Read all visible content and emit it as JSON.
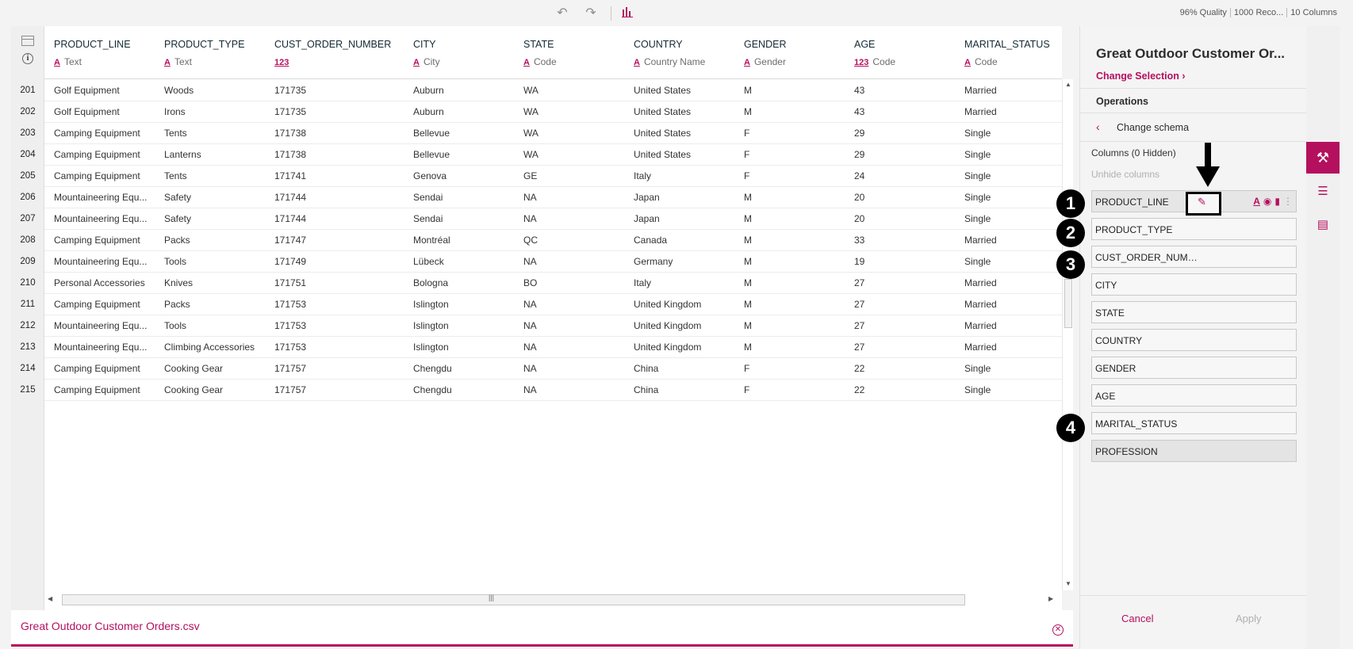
{
  "toolbar": {
    "undo_icon": "undo-icon",
    "redo_icon": "redo-icon",
    "chart_icon": "bar-chart-icon",
    "quality": "96% Quality",
    "records": "1000 Reco...",
    "columns": "10 Columns"
  },
  "grid": {
    "columns": [
      {
        "name": "PRODUCT_LINE",
        "glyph": "A",
        "type": "Text"
      },
      {
        "name": "PRODUCT_TYPE",
        "glyph": "A",
        "type": "Text"
      },
      {
        "name": "CUST_ORDER_NUMBER",
        "glyph": "123",
        "type": ""
      },
      {
        "name": "CITY",
        "glyph": "A",
        "type": "City"
      },
      {
        "name": "STATE",
        "glyph": "A",
        "type": "Code"
      },
      {
        "name": "COUNTRY",
        "glyph": "A",
        "type": "Country Name"
      },
      {
        "name": "GENDER",
        "glyph": "A",
        "type": "Gender"
      },
      {
        "name": "AGE",
        "glyph": "123",
        "type": "Code"
      },
      {
        "name": "MARITAL_STATUS",
        "glyph": "A",
        "type": "Code"
      }
    ],
    "rows": [
      {
        "n": "201",
        "cells": [
          "Golf Equipment",
          "Woods",
          "171735",
          "Auburn",
          "WA",
          "United States",
          "M",
          "43",
          "Married"
        ]
      },
      {
        "n": "202",
        "cells": [
          "Golf Equipment",
          "Irons",
          "171735",
          "Auburn",
          "WA",
          "United States",
          "M",
          "43",
          "Married"
        ]
      },
      {
        "n": "203",
        "cells": [
          "Camping Equipment",
          "Tents",
          "171738",
          "Bellevue",
          "WA",
          "United States",
          "F",
          "29",
          "Single"
        ]
      },
      {
        "n": "204",
        "cells": [
          "Camping Equipment",
          "Lanterns",
          "171738",
          "Bellevue",
          "WA",
          "United States",
          "F",
          "29",
          "Single"
        ]
      },
      {
        "n": "205",
        "cells": [
          "Camping Equipment",
          "Tents",
          "171741",
          "Genova",
          "GE",
          "Italy",
          "F",
          "24",
          "Single"
        ]
      },
      {
        "n": "206",
        "cells": [
          "Mountaineering Equ...",
          "Safety",
          "171744",
          "Sendai",
          "NA",
          "Japan",
          "M",
          "20",
          "Single"
        ]
      },
      {
        "n": "207",
        "cells": [
          "Mountaineering Equ...",
          "Safety",
          "171744",
          "Sendai",
          "NA",
          "Japan",
          "M",
          "20",
          "Single"
        ]
      },
      {
        "n": "208",
        "cells": [
          "Camping Equipment",
          "Packs",
          "171747",
          "Montréal",
          "QC",
          "Canada",
          "M",
          "33",
          "Married"
        ]
      },
      {
        "n": "209",
        "cells": [
          "Mountaineering Equ...",
          "Tools",
          "171749",
          "Lübeck",
          "NA",
          "Germany",
          "M",
          "19",
          "Single"
        ]
      },
      {
        "n": "210",
        "cells": [
          "Personal Accessories",
          "Knives",
          "171751",
          "Bologna",
          "BO",
          "Italy",
          "M",
          "27",
          "Married"
        ]
      },
      {
        "n": "211",
        "cells": [
          "Camping Equipment",
          "Packs",
          "171753",
          "Islington",
          "NA",
          "United Kingdom",
          "M",
          "27",
          "Married"
        ]
      },
      {
        "n": "212",
        "cells": [
          "Mountaineering Equ...",
          "Tools",
          "171753",
          "Islington",
          "NA",
          "United Kingdom",
          "M",
          "27",
          "Married"
        ]
      },
      {
        "n": "213",
        "cells": [
          "Mountaineering Equ...",
          "Climbing Accessories",
          "171753",
          "Islington",
          "NA",
          "United Kingdom",
          "M",
          "27",
          "Married"
        ]
      },
      {
        "n": "214",
        "cells": [
          "Camping Equipment",
          "Cooking Gear",
          "171757",
          "Chengdu",
          "NA",
          "China",
          "F",
          "22",
          "Single"
        ]
      },
      {
        "n": "215",
        "cells": [
          "Camping Equipment",
          "Cooking Gear",
          "171757",
          "Chengdu",
          "NA",
          "China",
          "F",
          "22",
          "Single"
        ]
      }
    ]
  },
  "file": {
    "name": "Great Outdoor Customer Orders.csv"
  },
  "panel": {
    "title": "Great Outdoor Customer Or...",
    "change_selection": "Change Selection",
    "operations": "Operations",
    "change_schema": "Change schema",
    "columns_count": "Columns (0 Hidden)",
    "unhide": "Unhide columns",
    "column_items": [
      "PRODUCT_LINE",
      "PRODUCT_TYPE",
      "CUST_ORDER_NUMB...",
      "CITY",
      "STATE",
      "COUNTRY",
      "GENDER",
      "AGE",
      "MARITAL_STATUS",
      "PROFESSION"
    ],
    "cancel": "Cancel",
    "apply": "Apply"
  },
  "markers": [
    "1",
    "2",
    "3",
    "4"
  ],
  "colors": {
    "accent": "#b4105e"
  }
}
